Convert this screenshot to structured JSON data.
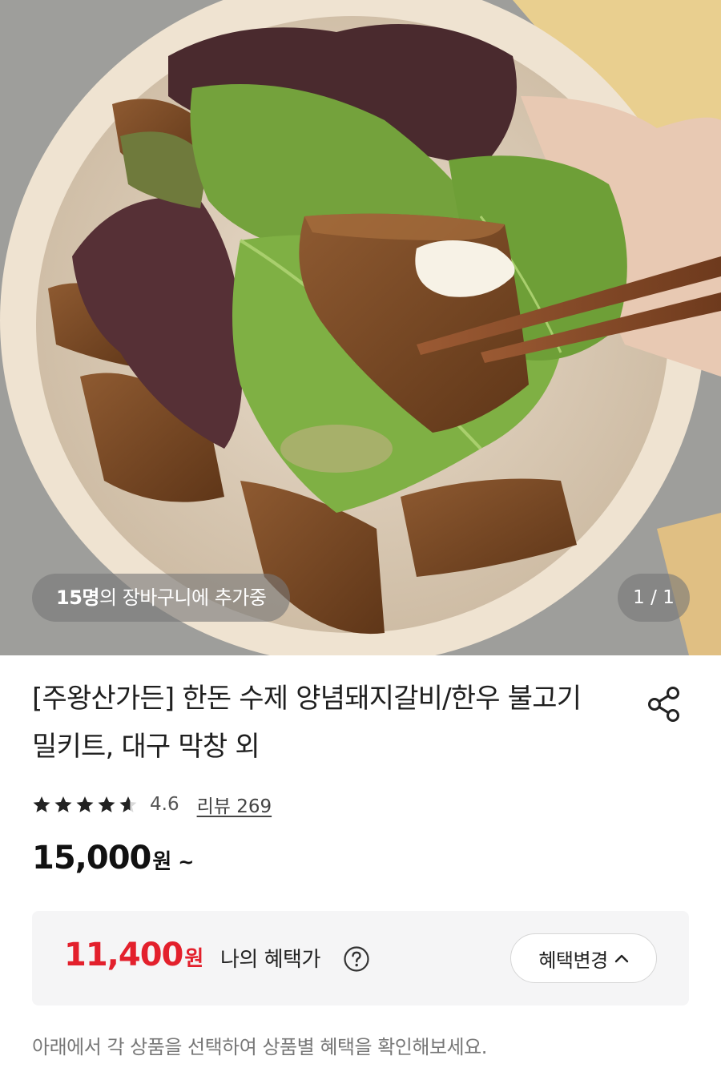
{
  "product_image": {
    "cart_count": "15명",
    "cart_text": "의 장바구니에 추가중",
    "counter_current": "1",
    "counter_separator": " / ",
    "counter_total": "1"
  },
  "product": {
    "title": "[주왕산가든] 한돈 수제 양념돼지갈비/한우 불고기 밀키트, 대구 막창 외",
    "rating": "4.6",
    "rating_stars": 4.6,
    "review_link": "리뷰 269",
    "price": "15,000",
    "price_unit": "원",
    "price_suffix": "~"
  },
  "benefit": {
    "price": "11,400",
    "price_unit": "원",
    "label": "나의 혜택가",
    "change_button": "혜택변경"
  },
  "notice": "아래에서 각 상품을 선택하여 상품별 혜택을 확인해보세요.",
  "icons": [
    "share-icon",
    "star-icon",
    "help-circle-icon",
    "chevron-up-icon"
  ],
  "colors": {
    "accent_red": "#e3202c",
    "text_dark": "#1f1f1f",
    "text_muted": "#777777",
    "panel_bg": "#f5f5f6"
  }
}
